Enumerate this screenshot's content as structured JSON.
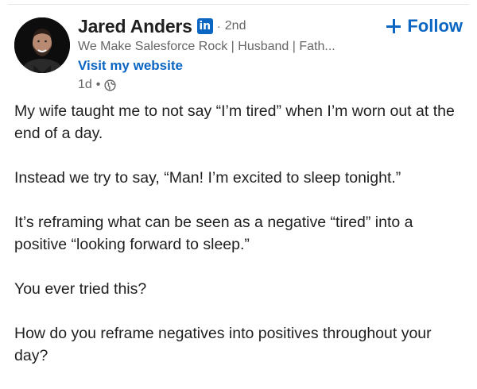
{
  "author": {
    "name": "Jared Anders",
    "badge": "in",
    "separator": "·",
    "degree": "2nd",
    "headline": "We Make Salesforce Rock | Husband | Fath...",
    "website_link": "Visit my website",
    "time": "1d",
    "time_separator": "•",
    "visibility_icon": "globe-icon"
  },
  "follow": {
    "label": "Follow",
    "icon": "plus-icon"
  },
  "post": {
    "paragraphs": [
      "My wife taught me to not say “I’m tired” when I’m worn out at the end of a day.",
      "Instead we try to say, “Man! I’m excited to sleep tonight.”",
      "It’s reframing what can be seen as a negative “tired” into a positive “looking forward to sleep.”",
      "You ever tried this?",
      "How do you reframe negatives into positives throughout your day?"
    ]
  },
  "colors": {
    "accent": "#0a66c2",
    "secondary_text": "#666666",
    "primary_text": "#1f1f1f"
  }
}
